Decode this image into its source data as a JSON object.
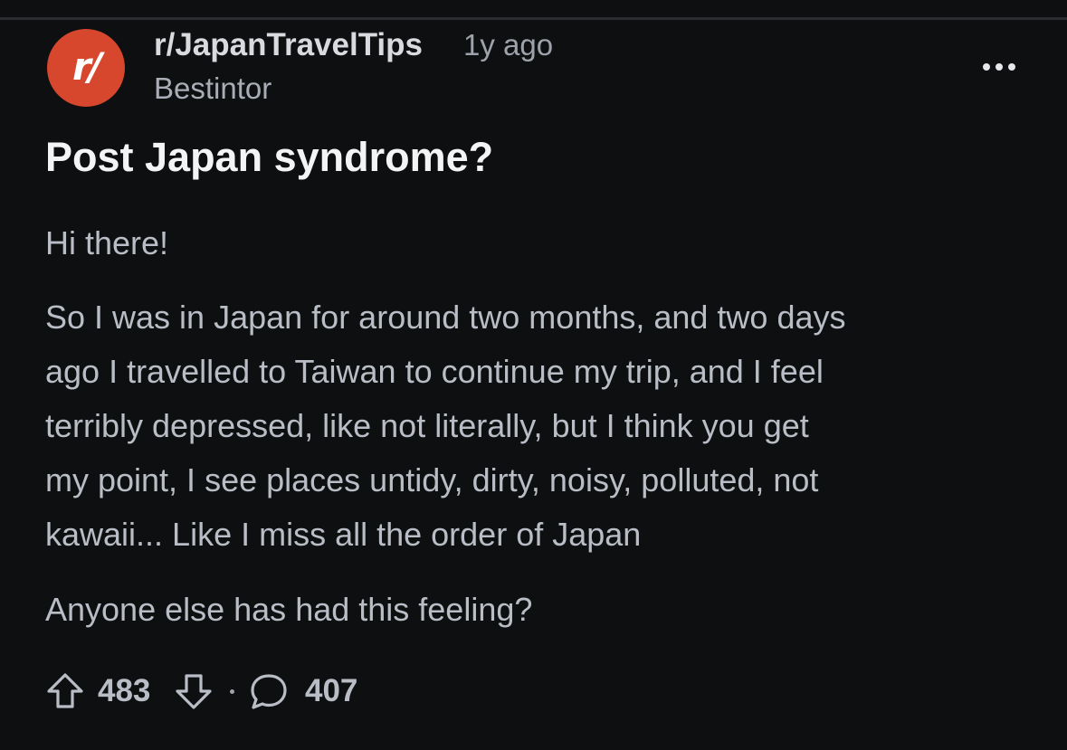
{
  "post": {
    "subreddit_icon_text": "r/",
    "subreddit": "r/JapanTravelTips",
    "age": "1y ago",
    "author": "Bestintor",
    "title": "Post Japan syndrome?",
    "body": {
      "p1": [
        "Hi there!"
      ],
      "p2": [
        "So I was in Japan for around two months, and two days",
        "ago I travelled to Taiwan to continue my trip, and I feel",
        "terribly depressed, like not literally, but I think you get",
        "my point, I see places untidy, dirty, noisy, polluted, not",
        "kawaii... Like I miss all the order of Japan"
      ],
      "p3": [
        "Anyone else has had this feeling?"
      ]
    },
    "votes": "483",
    "comments": "407"
  },
  "icons": {
    "more": "more-options-icon",
    "upvote": "upvote-arrow-icon",
    "downvote": "downvote-arrow-icon",
    "comment": "comment-bubble-icon"
  },
  "colors": {
    "background": "#0e0f11",
    "avatar": "#d7472e",
    "title": "#f3f4f6",
    "body_text": "#b9bec6",
    "meta_text": "#9ea3ab"
  }
}
